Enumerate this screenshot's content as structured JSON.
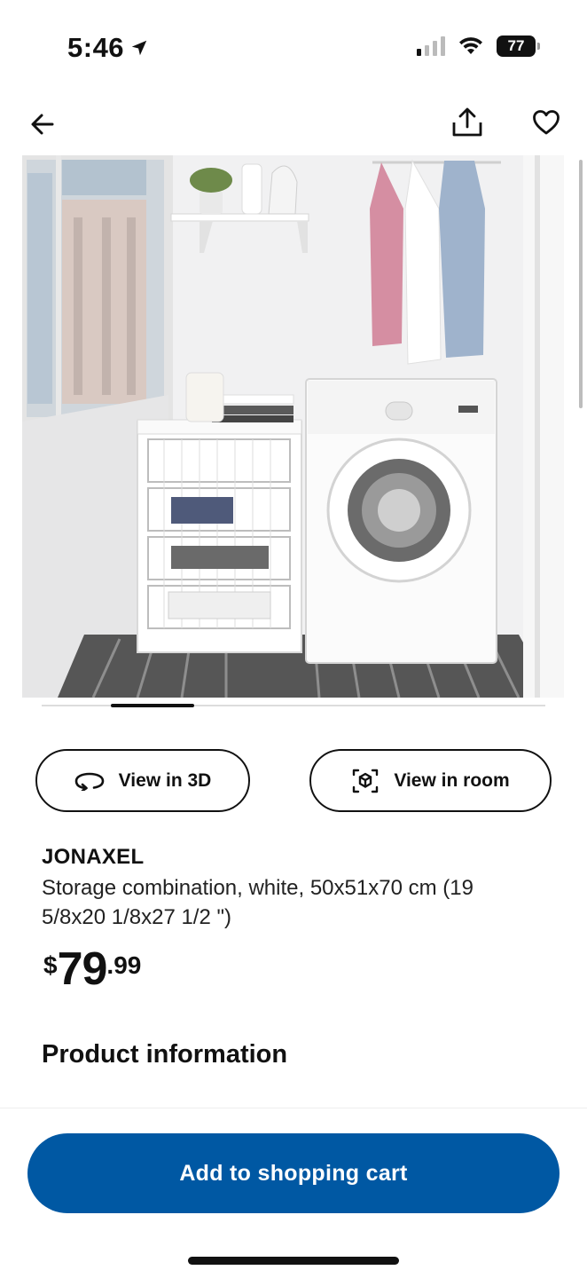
{
  "status_bar": {
    "time": "5:46",
    "battery": "77"
  },
  "nav": {
    "back_icon": "arrow-left-icon",
    "share_icon": "share-icon",
    "favorite_icon": "heart-icon"
  },
  "hero": {
    "carousel_position": 0.15
  },
  "actions": {
    "view_3d_label": "View in 3D",
    "view_room_label": "View in room"
  },
  "product": {
    "name": "JONAXEL",
    "description": "Storage combination, white, 50x51x70 cm (19 5/8x20 1/8x27 1/2 \")",
    "price_currency": "$",
    "price_whole": "79",
    "price_decimal": ".99"
  },
  "sections": {
    "product_information": "Product information"
  },
  "cart": {
    "label": "Add to shopping cart",
    "color": "#0058a3"
  }
}
